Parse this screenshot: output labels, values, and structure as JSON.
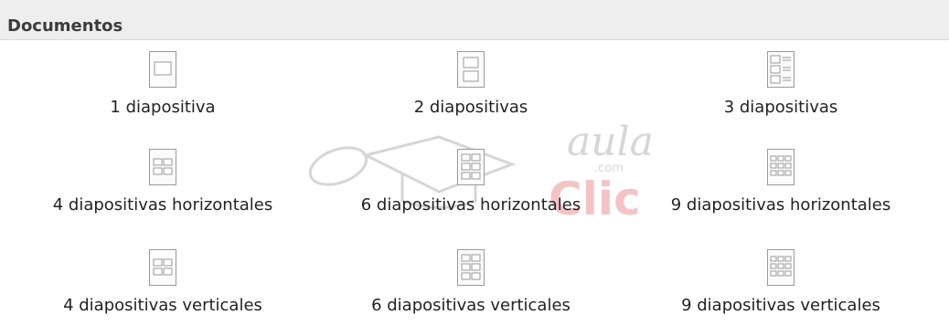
{
  "section": {
    "title": "Documentos"
  },
  "items": [
    {
      "label": "1 diapositiva",
      "icon": "one-slide-icon"
    },
    {
      "label": "2 diapositivas",
      "icon": "two-slides-icon"
    },
    {
      "label": "3 diapositivas",
      "icon": "three-slides-icon"
    },
    {
      "label": "4 diapositivas horizontales",
      "icon": "four-slides-horizontal-icon"
    },
    {
      "label": "6 diapositivas horizontales",
      "icon": "six-slides-horizontal-icon"
    },
    {
      "label": "9 diapositivas horizontales",
      "icon": "nine-slides-horizontal-icon"
    },
    {
      "label": "4 diapositivas verticales",
      "icon": "four-slides-vertical-icon"
    },
    {
      "label": "6 diapositivas verticales",
      "icon": "six-slides-vertical-icon"
    },
    {
      "label": "9 diapositivas verticales",
      "icon": "nine-slides-vertical-icon"
    }
  ],
  "watermark": {
    "text_top": "aula",
    "text_bottom": "Clic",
    "domain": ".com"
  },
  "colors": {
    "header_bg": "#eeeeee",
    "icon_stroke": "#9a9a9a",
    "watermark_gray": "#d6d6d6",
    "watermark_red": "#f4c4c4"
  }
}
